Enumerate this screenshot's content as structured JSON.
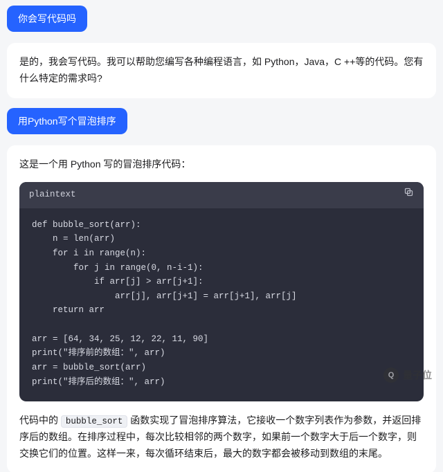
{
  "messages": {
    "user1": "你会写代码吗",
    "assistant1": "是的，我会写代码。我可以帮助您编写各种编程语言，如 Python，Java，C ++等的代码。您有什么特定的需求吗?",
    "user2": "用Python写个冒泡排序",
    "assistant2_intro": "这是一个用 Python 写的冒泡排序代码：",
    "code_lang_label": "plaintext",
    "code_content": "def bubble_sort(arr):\n    n = len(arr)\n    for i in range(n):\n        for j in range(0, n-i-1):\n            if arr[j] > arr[j+1]:\n                arr[j], arr[j+1] = arr[j+1], arr[j]\n    return arr\n\narr = [64, 34, 25, 12, 22, 11, 90]\nprint(\"排序前的数组：\", arr)\narr = bubble_sort(arr)\nprint(\"排序后的数组：\", arr)",
    "assistant2_explain_pre": "代码中的 ",
    "assistant2_inline_code": "bubble_sort",
    "assistant2_explain_post": " 函数实现了冒泡排序算法，它接收一个数字列表作为参数，并返回排序后的数组。在排序过程中，每次比较相邻的两个数字，如果前一个数字大于后一个数字，则交换它们的位置。这样一来，每次循环结束后，最大的数字都会被移动到数组的末尾。"
  },
  "watermark": {
    "logo_text": "Q",
    "text": "量子位"
  }
}
